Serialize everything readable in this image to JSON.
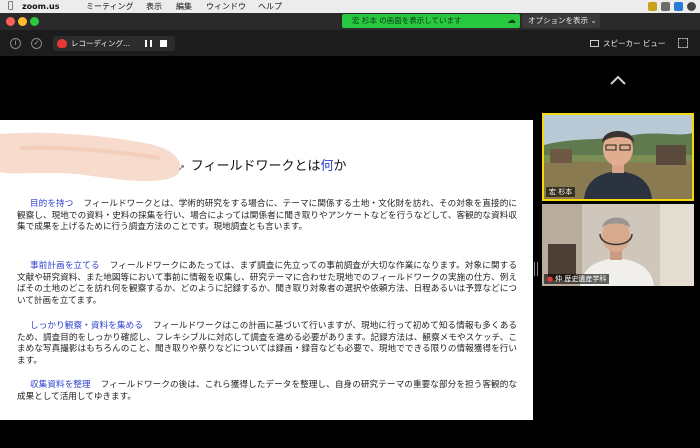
{
  "menubar": {
    "app_name": "zoom.us",
    "items": [
      "ミーティング",
      "表示",
      "編集",
      "ウィンドウ",
      "ヘルプ"
    ]
  },
  "titlebar": {
    "share_banner": "宏 杉本 の画面を表示しています",
    "options_button": "オプションを表示"
  },
  "toolbar": {
    "recording_label": "レコーディング...",
    "view_button": "スピーカー ビュー"
  },
  "slide": {
    "title_prefix": "フィールドワークとは",
    "title_accent": "何",
    "title_suffix": "か",
    "paragraphs": [
      {
        "heading": "目的を持つ",
        "body": "フィールドワークとは、学術的研究をする場合に、テーマに関係する土地・文化財を訪れ、その対象を直接的に観察し、現地での資料・史料の採集を行い、場合によっては関係者に聞き取りやアンケートなどを行うなどして、客観的な資料収集で成果を上げるために行う調査方法のことです。現地調査とも言います。"
      },
      {
        "heading": "事前計画を立てる",
        "body": "フィールドワークにあたっては、まず調査に先立っての事前調査が大切な作業になります。対象に関する文献や研究資料、また地図等において事前に情報を収集し、研究テーマに合わせた現地でのフィールドワークの実施の仕方、例えばその土地のどこを訪れ何を観察するか、どのように記録するか、聞き取り対象者の選択や依頼方法、日程あるいは予算などについて計画を立てます。"
      },
      {
        "heading": "しっかり観察・資料を集める",
        "body": "フィールドワークはこの計画に基づいて行いますが、現地に行って初めて知る情報も多くあるため、調査目的をしっかり確認し、フレキシブルに対応して調査を進める必要があります。記録方法は、観察メモやスケッチ、こまめな写真撮影はもちろんのこと、聞き取りや祭りなどについては録画・録音なども必要で、現地でできる限りの情報獲得を行います。"
      },
      {
        "heading": "収集資料を整理",
        "body": "フィールドワークの後は、これら獲得したデータを整理し、自身の研究テーマの重要な部分を担う客観的な成果として活用してゆきます。"
      }
    ]
  },
  "participants": [
    {
      "name": "宏 杉本",
      "active": true
    },
    {
      "name": "仲 歴史遺産学科",
      "muted": true
    }
  ],
  "colors": {
    "share_green": "#28c840",
    "accent_blue": "#2d3fce",
    "active_speaker": "#f5d90a",
    "record_red": "#e53935"
  }
}
